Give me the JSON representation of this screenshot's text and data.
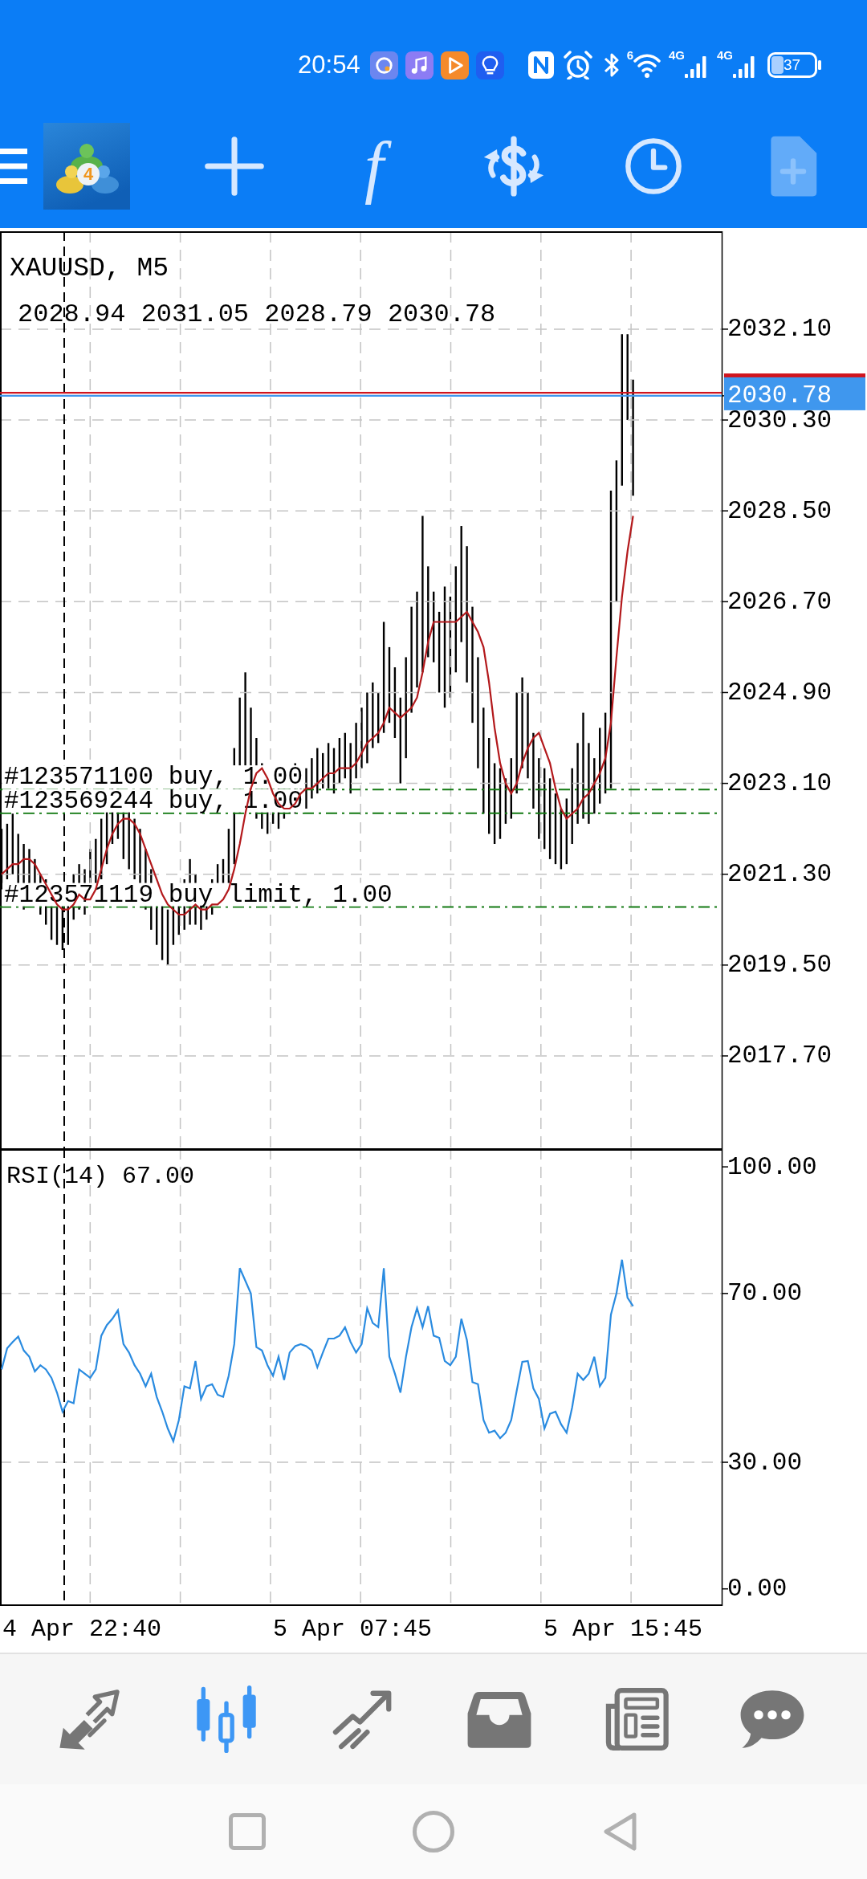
{
  "status_bar": {
    "time": "20:54",
    "wifi_badge": "6",
    "network_types": [
      "4G",
      "4G"
    ],
    "battery": "37"
  },
  "toolbar": {
    "logo_badge": "4",
    "buttons": [
      {
        "disabled": false
      },
      {
        "label": "f",
        "disabled": false
      },
      {
        "disabled": false
      },
      {
        "disabled": false
      },
      {
        "disabled": true
      }
    ]
  },
  "chart": {
    "ohlc": "2028.94 2031.05 2028.79 2030.78",
    "price_pane": {
      "chart_data": {
        "type": "line",
        "title": "XAUUSD, M5",
        "grid": true,
        "ylim": [
          2015.87,
          2034.04
        ],
        "yticks": [
          {
            "value": 2017.7,
            "label": "2017.70"
          },
          {
            "value": 2019.5,
            "label": "2019.50"
          },
          {
            "value": 2021.3,
            "label": "2021.30"
          },
          {
            "value": 2023.1,
            "label": "2023.10"
          },
          {
            "value": 2024.9,
            "label": "2024.90"
          },
          {
            "value": 2026.7,
            "label": "2026.70"
          },
          {
            "value": 2028.5,
            "label": "2028.50"
          },
          {
            "value": 2030.3,
            "label": "2030.30"
          },
          {
            "value": 2030.78,
            "label": "2030.78"
          },
          {
            "value": 2032.1,
            "label": "2032.10"
          }
        ],
        "series": [
          {
            "color": "#b3191c",
            "values": [
              2021.3,
              2021.4,
              2021.5,
              2021.5,
              2021.6,
              2021.6,
              2021.5,
              2021.3,
              2021.1,
              2020.9,
              2020.7,
              2020.6,
              2020.6,
              2020.7,
              2020.9,
              2020.8,
              2020.8,
              2021.0,
              2021.4,
              2021.8,
              2022.1,
              2022.3,
              2022.4,
              2022.4,
              2022.3,
              2022.1,
              2021.8,
              2021.5,
              2021.2,
              2020.9,
              2020.7,
              2020.6,
              2020.5,
              2020.5,
              2020.6,
              2020.7,
              2020.6,
              2020.6,
              2020.7,
              2020.7,
              2020.8,
              2021.0,
              2021.4,
              2021.9,
              2022.5,
              2023.0,
              2023.3,
              2023.4,
              2023.2,
              2022.9,
              2022.7,
              2022.6,
              2022.6,
              2022.7,
              2022.9,
              2023.0,
              2023.0,
              2023.1,
              2023.2,
              2023.3,
              2023.3,
              2023.4,
              2023.4,
              2023.4,
              2023.5,
              2023.7,
              2023.9,
              2024.0,
              2024.1,
              2024.3,
              2024.6,
              2024.5,
              2024.4,
              2024.5,
              2024.6,
              2024.8,
              2025.3,
              2025.9,
              2026.3,
              2026.3,
              2026.3,
              2026.3,
              2026.3,
              2026.4,
              2026.5,
              2026.3,
              2026.1,
              2025.8,
              2025.1,
              2024.2,
              2023.5,
              2023.1,
              2022.9,
              2023.1,
              2023.5,
              2023.8,
              2024.0,
              2024.1,
              2023.8,
              2023.5,
              2023.0,
              2022.6,
              2022.4,
              2022.5,
              2022.6,
              2022.8,
              2022.9,
              2023.1,
              2023.3,
              2023.6,
              2024.3,
              2025.6,
              2026.8,
              2027.7,
              2028.4
            ]
          }
        ],
        "ref_lines": [
          {
            "axis": "y",
            "value": 2030.84,
            "color": "#d0141e"
          },
          {
            "axis": "y",
            "value": 2030.78,
            "color": "#3f97ee"
          },
          {
            "axis": "y",
            "value": 2022.98,
            "color": "#137a13",
            "label": "#123571100 buy, 1.00"
          },
          {
            "axis": "y",
            "value": 2022.51,
            "color": "#137a13",
            "label": "#123569244 buy, 1.00"
          },
          {
            "axis": "y",
            "value": 2020.65,
            "color": "#137a13",
            "label": "#123571119 buy limit, 1.00"
          }
        ]
      }
    },
    "rsi_pane": {
      "chart_data": {
        "type": "line",
        "title": "RSI(14) 67.00",
        "grid": true,
        "ylim": [
          -4.05,
          104.4
        ],
        "yticks": [
          {
            "value": 0,
            "label": "0.00"
          },
          {
            "value": 30,
            "label": "30.00"
          },
          {
            "value": 70,
            "label": "70.00"
          },
          {
            "value": 100,
            "label": "100.00"
          }
        ],
        "series": [
          {
            "color": "#2a8be0",
            "values": [
              52,
              57,
              58.5,
              59.8,
              56.5,
              55,
              51.5,
              53,
              52,
              50,
              46.5,
              42,
              44.5,
              44,
              52,
              51,
              50,
              52,
              60,
              62.5,
              64,
              66,
              58,
              56,
              53,
              51,
              48,
              51,
              45.5,
              42,
              38,
              35,
              40,
              48,
              47.5,
              54,
              45,
              48,
              48.5,
              46,
              45.5,
              50.5,
              58,
              76,
              73,
              70,
              57.3,
              56.5,
              53,
              50.5,
              55,
              49.5,
              56,
              57.5,
              58,
              57.5,
              56.5,
              52.5,
              56,
              59.3,
              59.3,
              60,
              62,
              58.5,
              56,
              58,
              66.5,
              63,
              62,
              76,
              55,
              51,
              46.5,
              55,
              62,
              66.5,
              62,
              67,
              60,
              59.5,
              54,
              53,
              55,
              64,
              59,
              49,
              48.5,
              40,
              37,
              37.5,
              35.7,
              37,
              40,
              47,
              53.8,
              54,
              47.5,
              45,
              38,
              41.5,
              42,
              39,
              37,
              43,
              51,
              49.5,
              51,
              55,
              48,
              50,
              65,
              70,
              78,
              69,
              67
            ]
          }
        ]
      }
    },
    "time_axis": [
      "4 Apr 22:40",
      "5 Apr 07:45",
      "5 Apr 15:45"
    ]
  },
  "bottom_nav": {
    "tabs": [
      {
        "selected": false
      },
      {
        "selected": true
      },
      {
        "selected": false
      },
      {
        "selected": false
      },
      {
        "selected": false
      },
      {
        "selected": false
      }
    ]
  }
}
